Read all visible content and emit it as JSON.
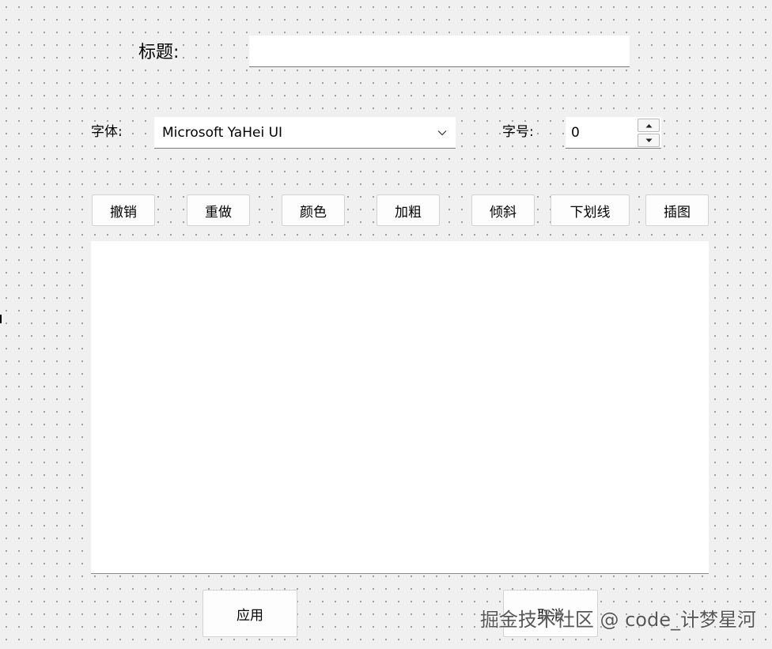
{
  "form": {
    "title_label": "标题:",
    "title_value": "",
    "font_label": "字体:",
    "font_value": "Microsoft YaHei UI",
    "size_label": "字号:",
    "size_value": "0"
  },
  "toolbar": [
    {
      "name": "undo-button",
      "label": "撤销"
    },
    {
      "name": "redo-button",
      "label": "重做"
    },
    {
      "name": "color-button",
      "label": "颜色"
    },
    {
      "name": "bold-button",
      "label": "加粗"
    },
    {
      "name": "italic-button",
      "label": "倾斜"
    },
    {
      "name": "underline-button",
      "label": "下划线"
    },
    {
      "name": "insert-image-button",
      "label": "插图"
    }
  ],
  "editor": {
    "content": ""
  },
  "footer": {
    "apply_label": "应用",
    "cancel_label": "取消"
  },
  "watermark": "掘金技术社区 @ code_计梦星河",
  "icons": {
    "combo": "chevron-down-icon",
    "spin_up": "arrow-up-icon",
    "spin_down": "arrow-down-icon"
  }
}
